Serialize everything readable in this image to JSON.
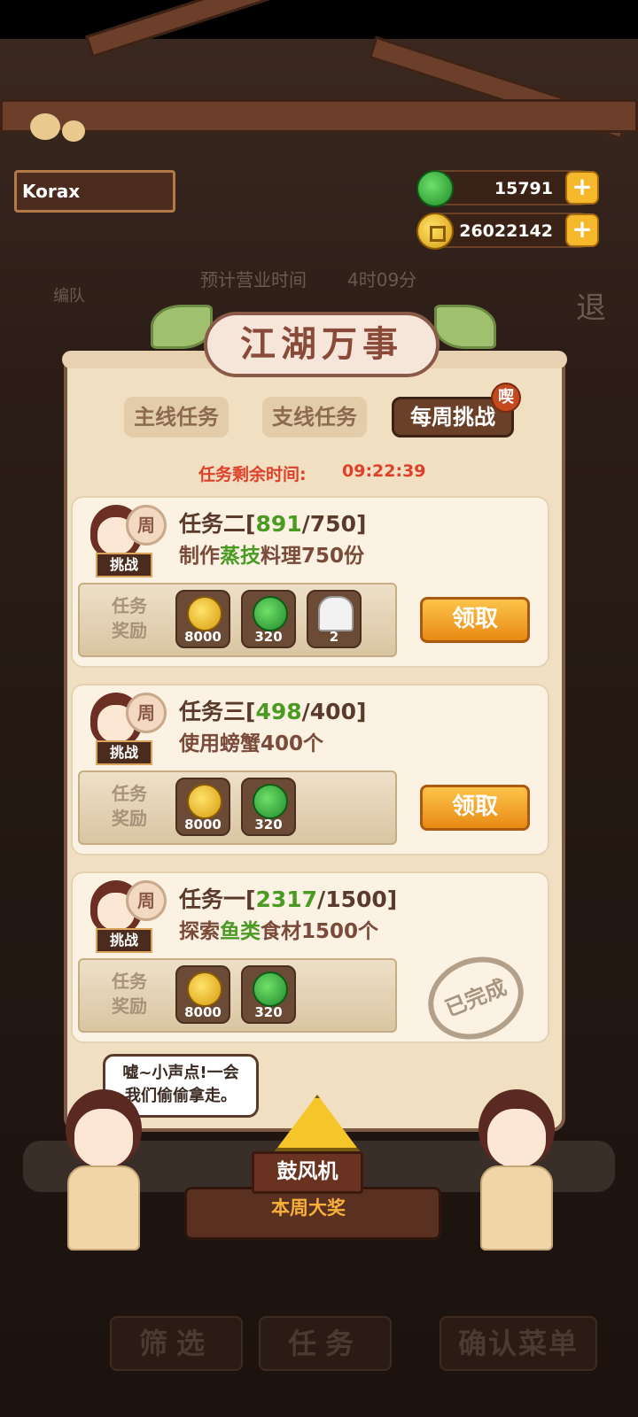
{
  "player": {
    "name": "Korax"
  },
  "currency": {
    "jade": {
      "icon": "jade-icon",
      "value": "15791"
    },
    "coins": {
      "icon": "coin-icon",
      "value": "26022142"
    }
  },
  "background": {
    "team_label": "编队",
    "business_time_label": "预计营业时间",
    "business_time_value": "4时09分",
    "exit_label": "退"
  },
  "panel": {
    "title": "江湖万事",
    "tabs": [
      {
        "label": "主线任务",
        "active": false
      },
      {
        "label": "支线任务",
        "active": false
      },
      {
        "label": "每周挑战",
        "active": true
      }
    ],
    "tab_badge": "喫",
    "timer_label": "任务剩余时间:",
    "timer_value": "09:22:39",
    "reward_label": "任务奖励",
    "avatar_zhou": "周",
    "avatar_tag": "挑战",
    "tasks": [
      {
        "name": "任务二",
        "current": "891",
        "target": "750",
        "desc_pre": "制作",
        "desc_hl": "蒸技",
        "desc_post": "料理750份",
        "rewards": [
          {
            "icon": "coin",
            "count": "8000"
          },
          {
            "icon": "jade",
            "count": "320"
          },
          {
            "icon": "rice-ball",
            "count": "2"
          }
        ],
        "status": "claim",
        "button_label": "领取"
      },
      {
        "name": "任务三",
        "current": "498",
        "target": "400",
        "desc_pre": "使用螃蟹400个",
        "desc_hl": "",
        "desc_post": "",
        "rewards": [
          {
            "icon": "coin",
            "count": "8000"
          },
          {
            "icon": "jade",
            "count": "320"
          }
        ],
        "status": "claim",
        "button_label": "领取"
      },
      {
        "name": "任务一",
        "current": "2317",
        "target": "1500",
        "desc_pre": "探索",
        "desc_hl": "鱼类",
        "desc_post": "食材1500个",
        "rewards": [
          {
            "icon": "coin",
            "count": "8000"
          },
          {
            "icon": "jade",
            "count": "320"
          }
        ],
        "status": "done",
        "stamp_label": "已完成"
      }
    ]
  },
  "npc": {
    "speech_line1": "嘘~小声点!一会",
    "speech_line2": "我们偷偷拿走。",
    "prize_name": "鼓风机",
    "prize_sub": "本周大奖"
  },
  "bottom_bar": {
    "filter_label": "筛选",
    "task_label": "任务",
    "confirm_label": "确认菜单"
  }
}
